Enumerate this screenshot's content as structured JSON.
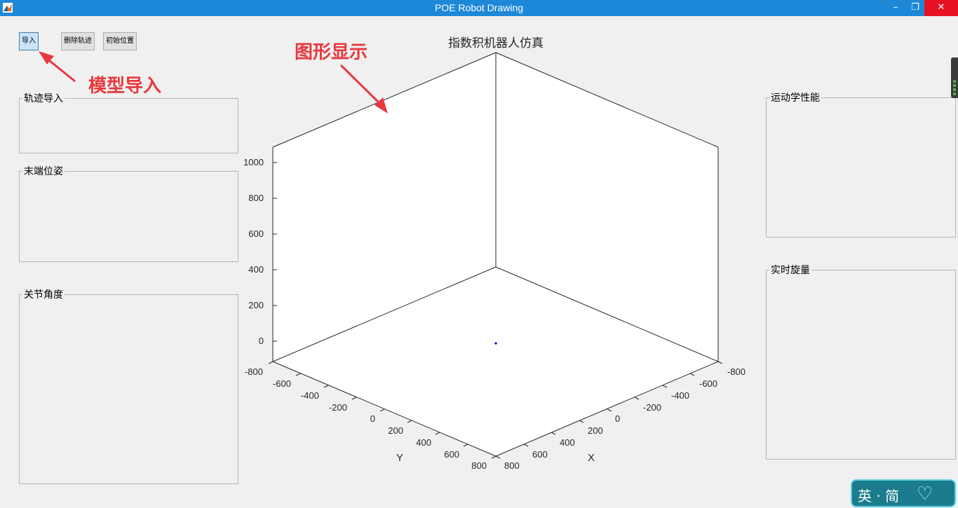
{
  "window": {
    "title": "POE Robot Drawing",
    "minimize_label": "–",
    "maximize_label": "❐",
    "close_label": "✕"
  },
  "toolbar": {
    "import_label": "导入",
    "delete_trajectory_label": "删除轨迹",
    "initial_position_label": "初始位置"
  },
  "panels": {
    "trajectory_import": "轨迹导入",
    "end_pose": "末端位姿",
    "joint_angles": "关节角度",
    "kinematic_performance": "运动学性能",
    "realtime_rotation": "实时旋量"
  },
  "annotations": {
    "model_import": "模型导入",
    "graphics_display": "图形显示",
    "color": "#e8383d"
  },
  "plot": {
    "title": "指数积机器人仿真",
    "xlabel": "X",
    "ylabel": "Y",
    "z_ticks": [
      "1000",
      "800",
      "600",
      "400",
      "200",
      "0"
    ],
    "y_ticks": [
      "-800",
      "-600",
      "-400",
      "-200",
      "0",
      "200",
      "400",
      "600",
      "800"
    ],
    "x_ticks": [
      "800",
      "600",
      "400",
      "200",
      "0",
      "-200",
      "-400",
      "-600",
      "-800"
    ],
    "point_color": "#0000cc"
  },
  "ime": {
    "text": "英 · 简",
    "icon": "heart-icon"
  }
}
